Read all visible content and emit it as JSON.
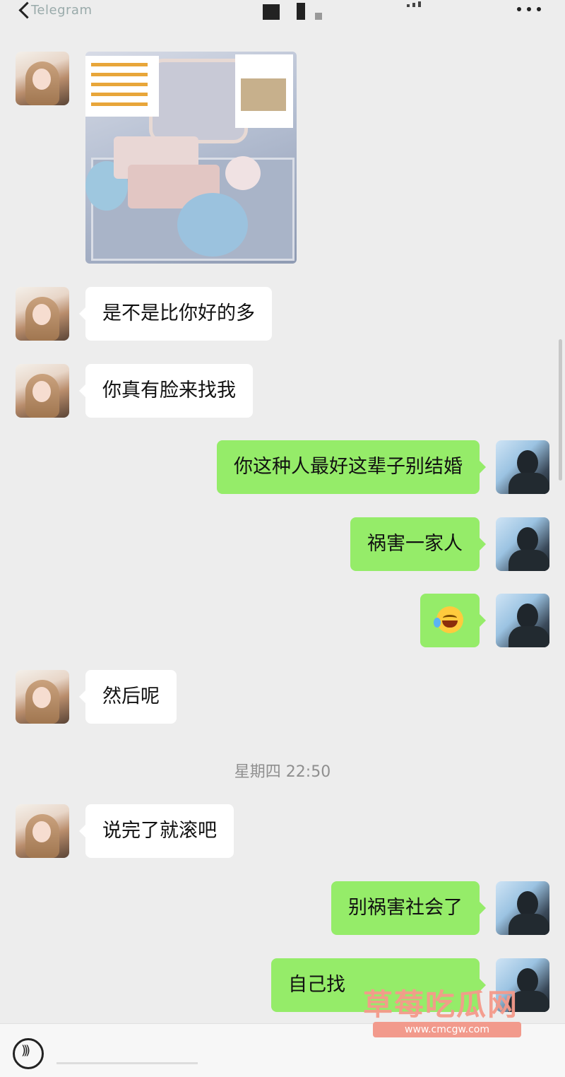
{
  "header": {
    "app_label": "Telegram",
    "back_icon": "chevron-left-icon",
    "more_icon": "more-dots-icon"
  },
  "messages": [
    {
      "side": "in",
      "type": "image"
    },
    {
      "side": "in",
      "text": "是不是比你好的多"
    },
    {
      "side": "in",
      "text": "你真有脸来找我"
    },
    {
      "side": "out",
      "text": "你这种人最好这辈子别结婚"
    },
    {
      "side": "out",
      "text": "祸害一家人"
    },
    {
      "side": "out",
      "type": "emoji",
      "emoji": "crying-laughing-emoji"
    },
    {
      "side": "in",
      "text": "然后呢"
    },
    {
      "side": "in",
      "text": "说完了就滚吧"
    },
    {
      "side": "out",
      "text": "别祸害社会了"
    },
    {
      "side": "out",
      "text": "自己找"
    }
  ],
  "timestamp": "星期四 22:50",
  "watermark": {
    "title": "草莓吃瓜网",
    "url": "www.cmcgw.com"
  },
  "bottom_bar": {
    "voice_icon": "voice-input-icon"
  },
  "colors": {
    "background": "#ededed",
    "incoming_bubble": "#ffffff",
    "outgoing_bubble": "#95ec69"
  }
}
